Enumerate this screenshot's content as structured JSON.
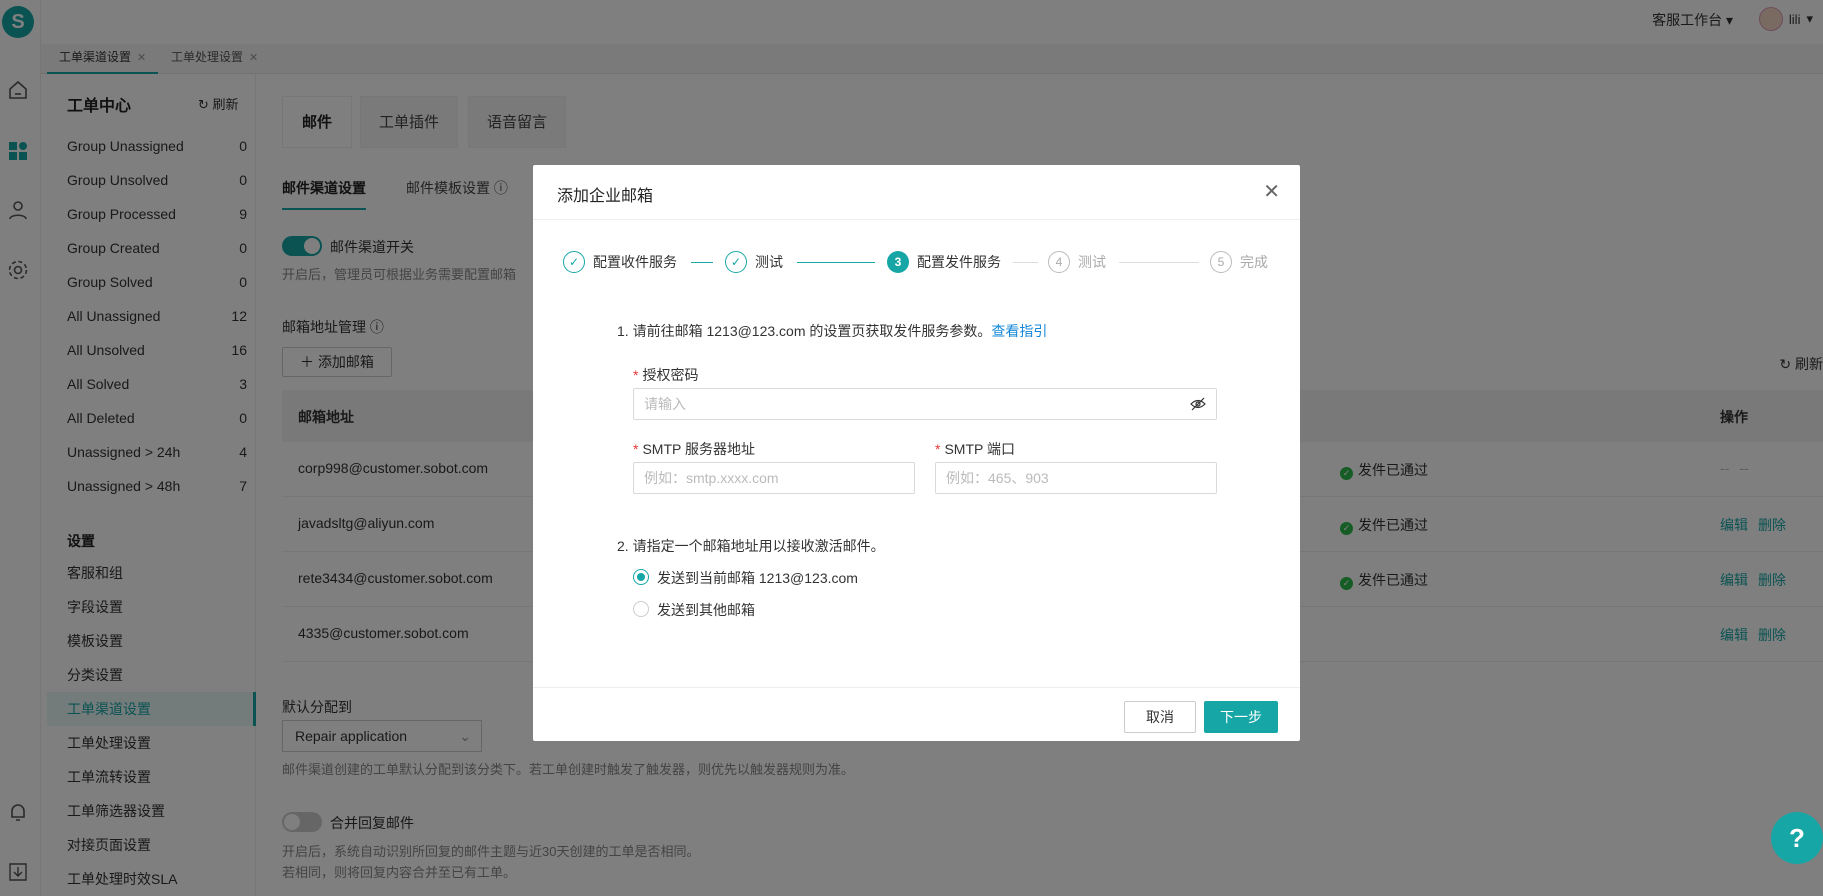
{
  "topbar": {
    "workspace": "客服工作台",
    "username": "lili"
  },
  "page_tabs": [
    {
      "label": "工单渠道设置"
    },
    {
      "label": "工单处理设置"
    }
  ],
  "sidebar": {
    "title": "工单中心",
    "refresh": "刷新",
    "views": [
      {
        "label": "Group Unassigned",
        "count": "0"
      },
      {
        "label": "Group Unsolved",
        "count": "0"
      },
      {
        "label": "Group Processed",
        "count": "9"
      },
      {
        "label": "Group Created",
        "count": "0"
      },
      {
        "label": "Group Solved",
        "count": "0"
      },
      {
        "label": "All Unassigned",
        "count": "12"
      },
      {
        "label": "All Unsolved",
        "count": "16"
      },
      {
        "label": "All Solved",
        "count": "3"
      },
      {
        "label": "All Deleted",
        "count": "0"
      },
      {
        "label": "Unassigned > 24h",
        "count": "4"
      },
      {
        "label": "Unassigned > 48h",
        "count": "7"
      }
    ],
    "settings_title": "设置",
    "settings": [
      "客服和组",
      "字段设置",
      "模板设置",
      "分类设置",
      "工单渠道设置",
      "工单处理设置",
      "工单流转设置",
      "工单筛选器设置",
      "对接页面设置",
      "工单处理时效SLA"
    ]
  },
  "main": {
    "tabs": [
      "邮件",
      "工单插件",
      "语音留言"
    ],
    "subtabs": [
      "邮件渠道设置",
      "邮件模板设置"
    ],
    "mail_switch_label": "邮件渠道开关",
    "mail_switch_desc": "开启后，管理员可根据业务需要配置邮箱",
    "address_mgmt": "邮箱地址管理",
    "add_mail": "添加邮箱",
    "refresh": "刷新",
    "table_headers": {
      "address": "邮箱地址",
      "ops": "操作"
    },
    "rows": [
      {
        "email": "corp998@customer.sobot.com",
        "status": "发件已通过",
        "ops": [
          "--",
          "--"
        ]
      },
      {
        "email": "javadsltg@aliyun.com",
        "status": "发件已通过",
        "ops": [
          "编辑",
          "删除"
        ]
      },
      {
        "email": "rete3434@customer.sobot.com",
        "status": "发件已通过",
        "ops": [
          "编辑",
          "删除"
        ]
      },
      {
        "email": "4335@customer.sobot.com",
        "status": "",
        "ops": [
          "编辑",
          "删除"
        ]
      }
    ],
    "default_assign_label": "默认分配到",
    "default_assign_value": "Repair application",
    "default_assign_desc": "邮件渠道创建的工单默认分配到该分类下。若工单创建时触发了触发器，则优先以触发器规则为准。",
    "merge_label": "合并回复邮件",
    "merge_desc1": "开启后，系统自动识别所回复的邮件主题与近30天创建的工单是否相同。",
    "merge_desc2": "若相同，则将回复内容合并至已有工单。"
  },
  "modal": {
    "title": "添加企业邮箱",
    "steps": [
      {
        "num": "✓",
        "label": "配置收件服务",
        "state": "done"
      },
      {
        "num": "✓",
        "label": "测试",
        "state": "done"
      },
      {
        "num": "3",
        "label": "配置发件服务",
        "state": "current"
      },
      {
        "num": "4",
        "label": "测试",
        "state": "todo"
      },
      {
        "num": "5",
        "label": "完成",
        "state": "todo"
      }
    ],
    "instruction1_prefix": "1. 请前往邮箱 1213@123.com 的设置页获取发件服务参数。",
    "instruction1_link": "查看指引",
    "auth_label": "授权密码",
    "auth_placeholder": "请输入",
    "smtp_host_label": "SMTP 服务器地址",
    "smtp_host_placeholder": "例如：smtp.xxxx.com",
    "smtp_port_label": "SMTP 端口",
    "smtp_port_placeholder": "例如：465、903",
    "instruction2": "2. 请指定一个邮箱地址用以接收激活邮件。",
    "radio1": "发送到当前邮箱 1213@123.com",
    "radio2": "发送到其他邮箱",
    "cancel": "取消",
    "next": "下一步"
  },
  "colors": {
    "accent": "#17a6a6",
    "link": "#1688d8",
    "success": "#2db84a"
  },
  "icons": [
    "home-icon",
    "dashboard-icon",
    "user-icon",
    "settings-icon",
    "bell-icon",
    "download-icon",
    "close-icon",
    "eye-off-icon",
    "info-icon",
    "help-icon"
  ]
}
